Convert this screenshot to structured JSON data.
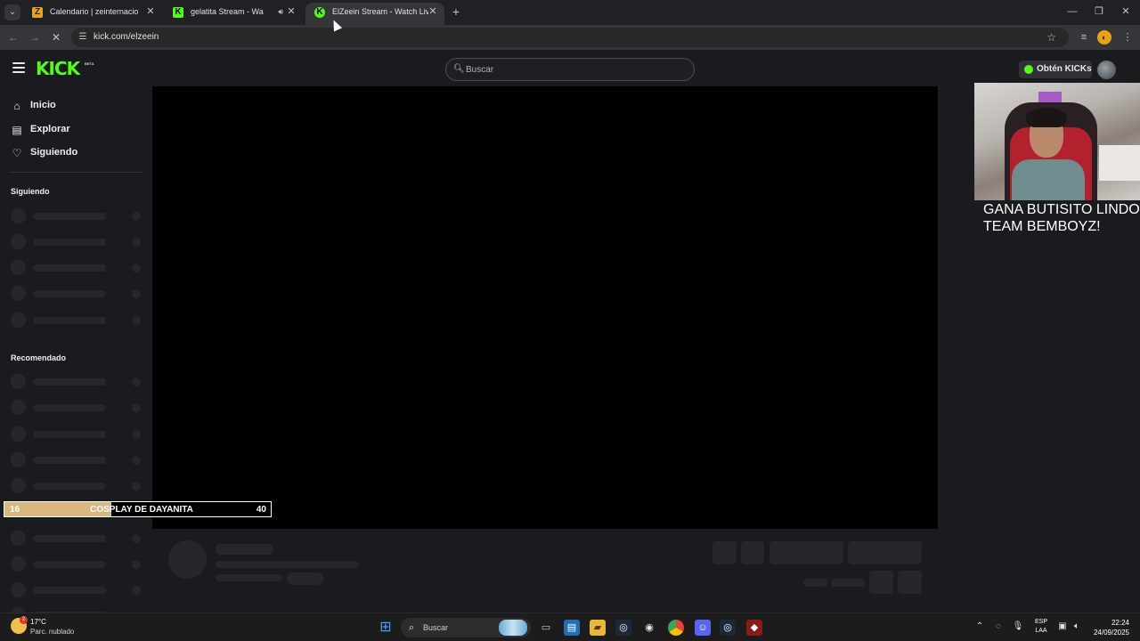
{
  "browser": {
    "tabs": [
      {
        "title": "Calendario | zeinternacional",
        "favicon": "Z",
        "active": false
      },
      {
        "title": "gelatita Stream - Watch Live on Kick",
        "favicon": "K",
        "active": false,
        "audio": true
      },
      {
        "title": "ElZeein Stream - Watch Live on Kick",
        "favicon": "K",
        "active": true
      }
    ],
    "address": "kick.com/elzeein"
  },
  "kick": {
    "search_placeholder": "Buscar",
    "kicks_button": "Obtén KICKs",
    "logo": "KICK",
    "logo_badge": "BETA",
    "nav": [
      {
        "label": "Inicio",
        "icon": "home-icon"
      },
      {
        "label": "Explorar",
        "icon": "explore-icon"
      },
      {
        "label": "Siguiendo",
        "icon": "heart-icon"
      }
    ],
    "section_following": "Siguiendo",
    "section_recommended": "Recomendado"
  },
  "overlay": {
    "text_line1": "GANA BUTISITO LINDO",
    "text_line2": "TEAM BEMBOYZ!",
    "goal_current": "16",
    "goal_name": "COSPLAY DE DAYANITA",
    "goal_target": "40",
    "goal_progress": 0.4
  },
  "taskbar": {
    "temperature": "17°C",
    "weather": "Parc. nublado",
    "weather_badge": "2",
    "search_label": "Buscar",
    "lang_line1": "ESP",
    "lang_line2": "LAA",
    "time": "22:24",
    "date": "24/09/2025"
  },
  "colors": {
    "kick_green": "#53fc18",
    "page_bg": "#191b1f",
    "skeleton": "#25272c"
  }
}
